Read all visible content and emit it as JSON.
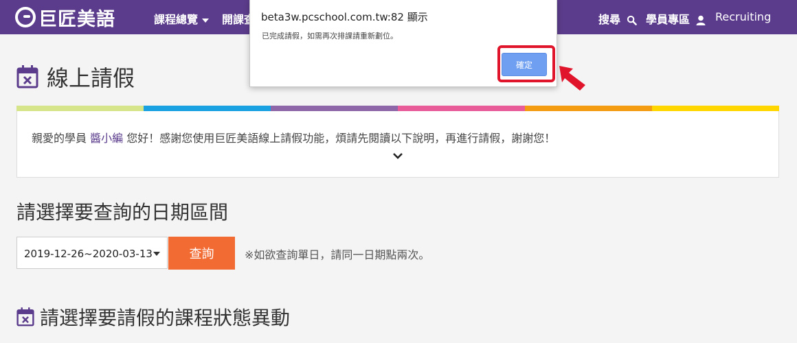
{
  "nav": {
    "logo_text": "巨匠美語",
    "items": [
      {
        "label": "課程總覽",
        "has_dropdown": true
      },
      {
        "label": "開課查"
      }
    ],
    "right_items": [
      {
        "label": "搜尋",
        "icon": "search-icon"
      },
      {
        "label": "學員專區",
        "icon": "user-icon"
      },
      {
        "label": "Recruiting"
      }
    ],
    "colors": {
      "background": "#5b3c8c",
      "text": "#ffffff"
    }
  },
  "page": {
    "title": "線上請假",
    "title_icon": "calendar-x-icon",
    "color_bar": [
      "#d6e58a",
      "#1aa1e1",
      "#8e67a8",
      "#e85c9a",
      "#f39c12",
      "#ffd600"
    ],
    "notice": {
      "prefix": "親愛的學員 ",
      "name": "醬小編",
      "suffix": " 您好！感謝您使用巨匠美語線上請假功能，煩請先閱讀以下說明，再進行請假，謝謝您！",
      "expand_icon": "chevron-down-icon"
    },
    "date_section": {
      "title": "請選擇要查詢的日期區間",
      "date_range": "2019-12-26~2020-03-13",
      "query_label": "查詢",
      "hint": "※如欲查詢單日，請同一日期點兩次。",
      "query_color": "#f26b33"
    },
    "section2_title": "請選擇要請假的課程狀態異動"
  },
  "dialog": {
    "origin": "beta3w.pcschool.com.tw:82 顯示",
    "message": "已完成請假，如需再次排課請重新劃位。",
    "ok_label": "確定",
    "highlight_color": "#e0142a",
    "ok_color": "#6f9ff0"
  }
}
